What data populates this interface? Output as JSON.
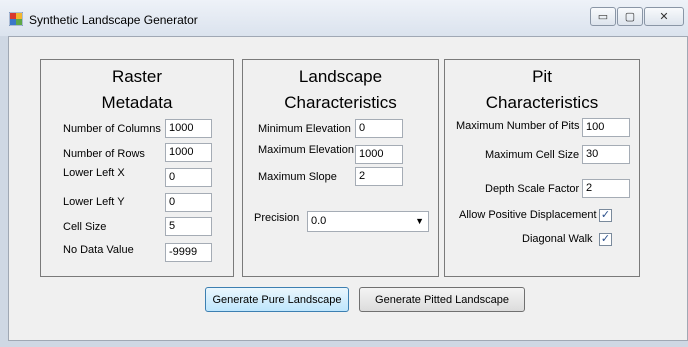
{
  "window": {
    "title": "Synthetic Landscape Generator",
    "controls": {
      "minimize": "▭",
      "maximize": "▢",
      "close": "✕"
    }
  },
  "raster": {
    "title_line1": "Raster",
    "title_line2": "Metadata",
    "fields": [
      {
        "label": "Number of Columns",
        "value": "1000"
      },
      {
        "label": "Number of Rows",
        "value": "1000"
      },
      {
        "label": "Lower Left X",
        "value": "0"
      },
      {
        "label": "Lower Left Y",
        "value": "0"
      },
      {
        "label": "Cell Size",
        "value": "5"
      },
      {
        "label": "No Data Value",
        "value": "-9999"
      }
    ]
  },
  "landscape": {
    "title_line1": "Landscape",
    "title_line2": "Characteristics",
    "fields": [
      {
        "label": "Minimum Elevation",
        "value": "0"
      },
      {
        "label": "Maximum Elevation",
        "value": "1000"
      },
      {
        "label": "Maximum Slope",
        "value": "2"
      }
    ],
    "precision_label": "Precision",
    "precision_value": "0.0"
  },
  "pit": {
    "title_line1": "Pit",
    "title_line2": "Characteristics",
    "fields": [
      {
        "label": "Maximum Number of Pits",
        "value": "100"
      },
      {
        "label": "Maximum Cell Size",
        "value": "30"
      },
      {
        "label": "Depth Scale Factor",
        "value": "2"
      }
    ],
    "allow_positive_label": "Allow Positive Displacement",
    "allow_positive_checked": true,
    "diagonal_walk_label": "Diagonal Walk",
    "diagonal_walk_checked": true
  },
  "buttons": {
    "pure": "Generate Pure Landscape",
    "pitted": "Generate Pitted Landscape"
  },
  "colors": {
    "accent": "#3c7fb1",
    "client_bg": "#f0f0f0"
  }
}
